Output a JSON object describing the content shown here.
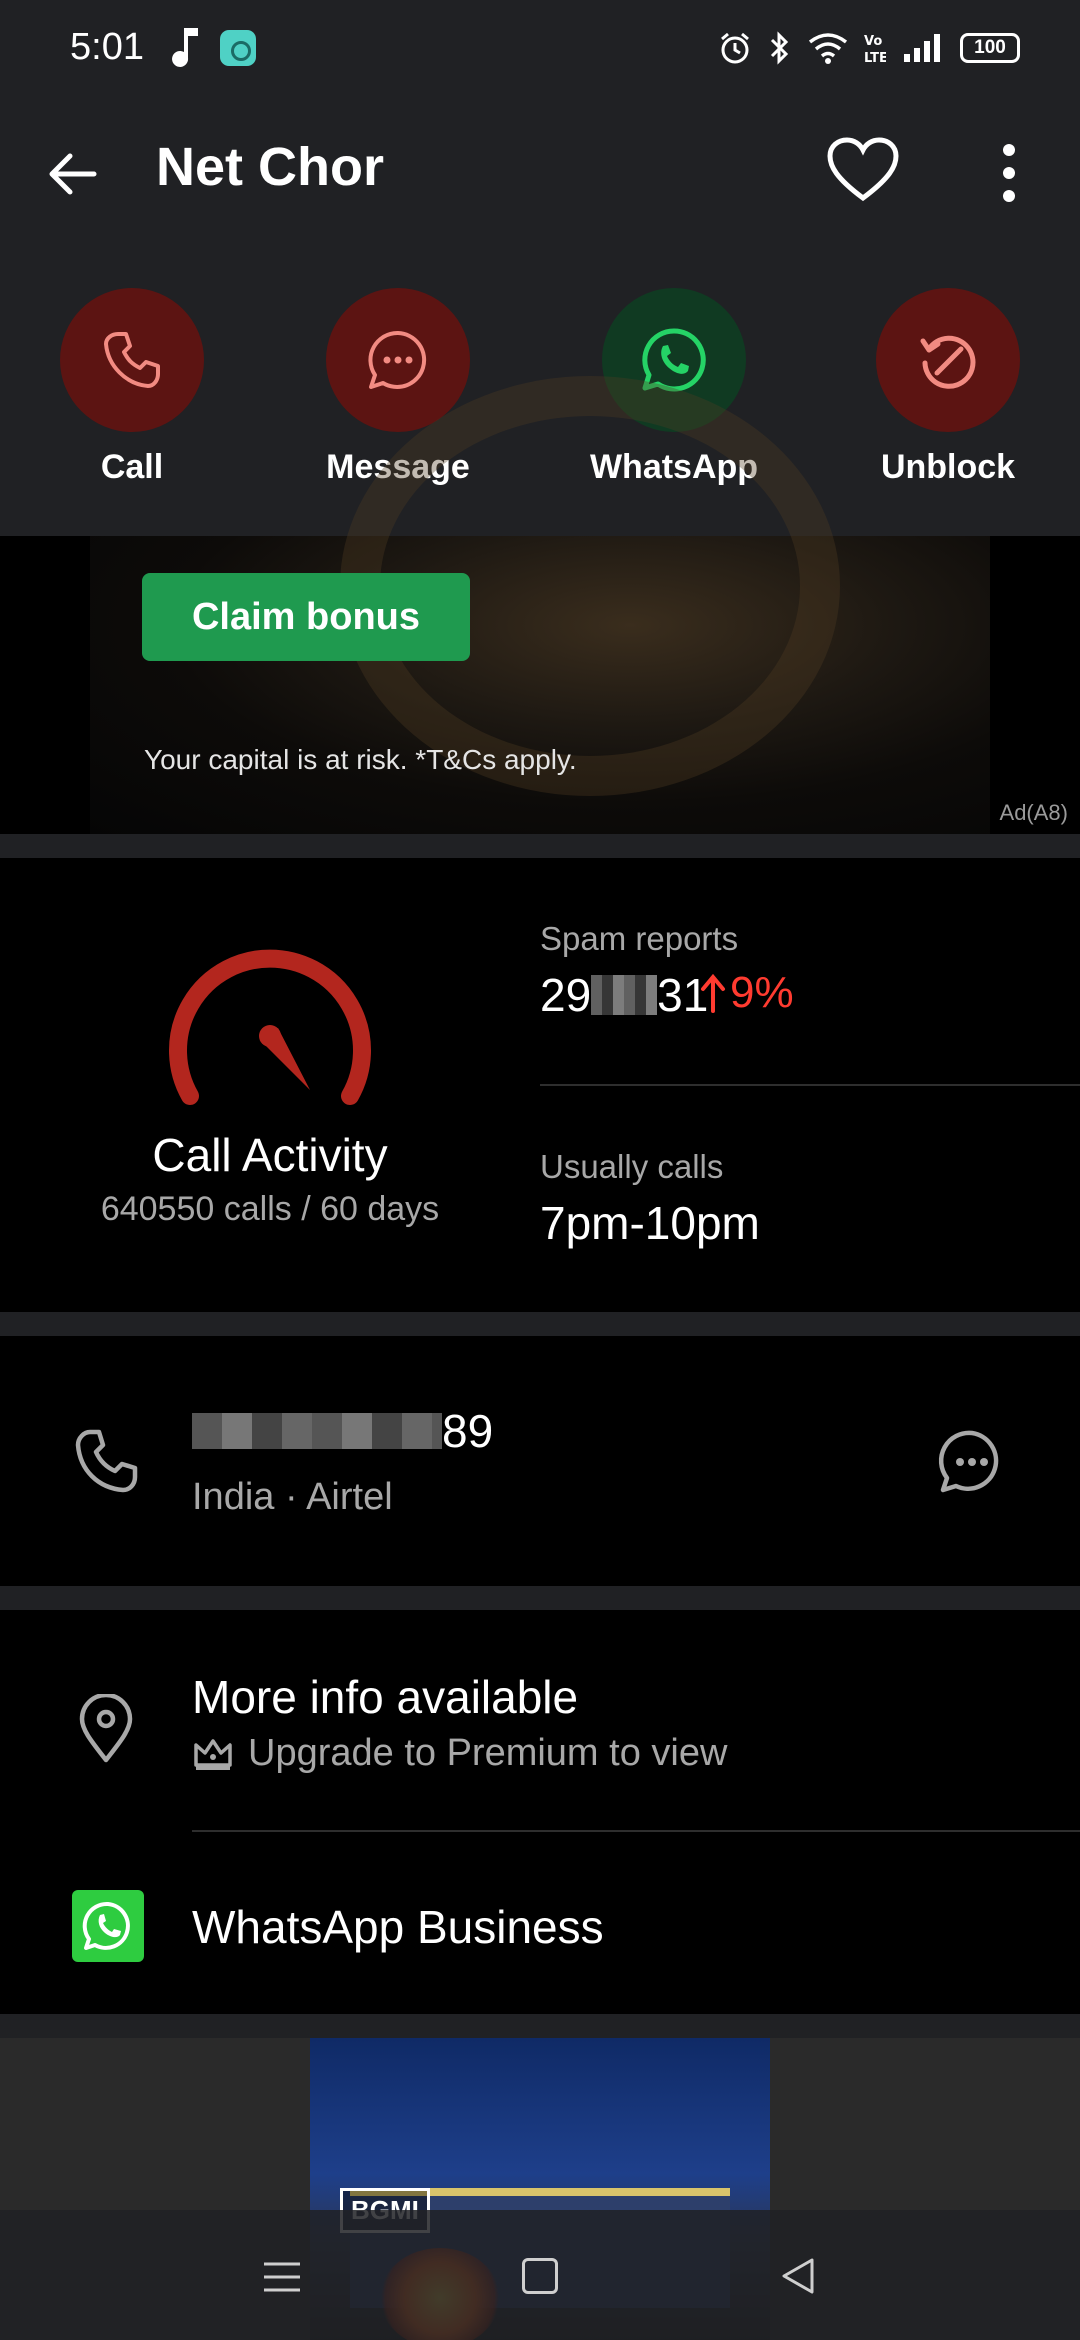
{
  "status_bar": {
    "time": "5:01",
    "battery": "100"
  },
  "header": {
    "title": "Net Chor"
  },
  "actions": [
    {
      "label": "Call",
      "icon": "phone-icon",
      "color": "#f28b82"
    },
    {
      "label": "Message",
      "icon": "chat-bubble-icon",
      "color": "#f28b82"
    },
    {
      "label": "WhatsApp",
      "icon": "whatsapp-icon",
      "color": "#25d366"
    },
    {
      "label": "Unblock",
      "icon": "unblock-icon",
      "color": "#f28b82"
    }
  ],
  "ad": {
    "button": "Claim bonus",
    "disclaimer": "Your capital is at risk. *T&Cs apply.",
    "tag": "Ad(A8)"
  },
  "stats": {
    "activity_title": "Call Activity",
    "activity_sub": "640550 calls / 60 days",
    "spam_label": "Spam reports",
    "spam_prefix": "29",
    "spam_suffix": "31",
    "spam_trend": "9%",
    "usually_label": "Usually calls",
    "usually_value": "7pm-10pm",
    "accent": "#b3261e",
    "trend_color": "#ff3b30"
  },
  "phone": {
    "number_suffix": "89",
    "meta": "India · Airtel"
  },
  "info": {
    "title": "More info available",
    "upgrade": "Upgrade to Premium to view",
    "whatsapp_business": "WhatsApp Business"
  },
  "bottom_ad": {
    "logo": "BGMI"
  }
}
